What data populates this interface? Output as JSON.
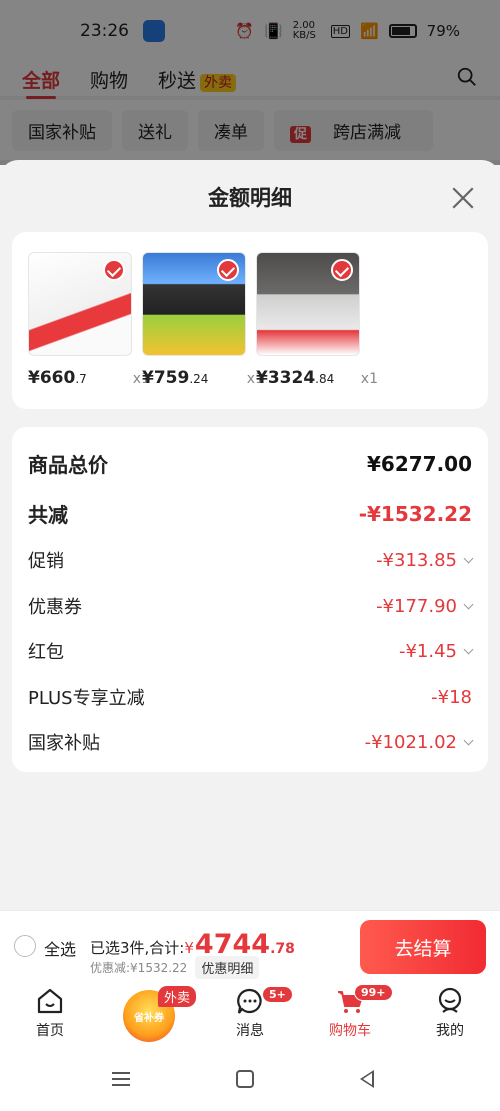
{
  "status_bar": {
    "time": "23:26",
    "network_speed": "2.00 KB/S",
    "battery": "79%"
  },
  "top_nav": {
    "tabs": [
      "全部",
      "购物",
      "秒送"
    ],
    "tag": "外卖"
  },
  "chips": [
    "国家补贴",
    "送礼",
    "凑单",
    "跨店满减"
  ],
  "chip_promo_icon": "促",
  "sheet": {
    "title": "金额明细",
    "products": [
      {
        "price_int": "¥660",
        "price_dec": ".7",
        "qty": "x1"
      },
      {
        "price_int": "¥759",
        "price_dec": ".24",
        "qty": "x1"
      },
      {
        "price_int": "¥3324",
        "price_dec": ".84",
        "qty": "x1"
      }
    ],
    "details": {
      "total_label": "商品总价",
      "total_value": "¥6277.00",
      "reduce_label": "共减",
      "reduce_value": "-¥1532.22",
      "promo_label": "促销",
      "promo_value": "-¥313.85",
      "coupon_label": "优惠券",
      "coupon_value": "-¥177.90",
      "redpack_label": "红包",
      "redpack_value": "-¥1.45",
      "plus_label": "PLUS专享立减",
      "plus_value": "-¥18",
      "subsidy_label": "国家补贴",
      "subsidy_value": "-¥1021.02"
    }
  },
  "checkout": {
    "select_all": "全选",
    "selected_text": "已选3件,合计:",
    "currency": "¥",
    "total_int": "4744",
    "total_dec": ".78",
    "discount_text": "优惠减:¥1532.22",
    "detail_btn": "优惠明细",
    "pay_btn": "去结算"
  },
  "tabbar": {
    "home": "首页",
    "center_badge": "外卖",
    "center_label": "省补券",
    "messages": "消息",
    "messages_badge": "5+",
    "cart": "购物车",
    "cart_badge": "99+",
    "me": "我的"
  },
  "colors": {
    "accent": "#e4393c",
    "background": "#f2f2f2"
  }
}
